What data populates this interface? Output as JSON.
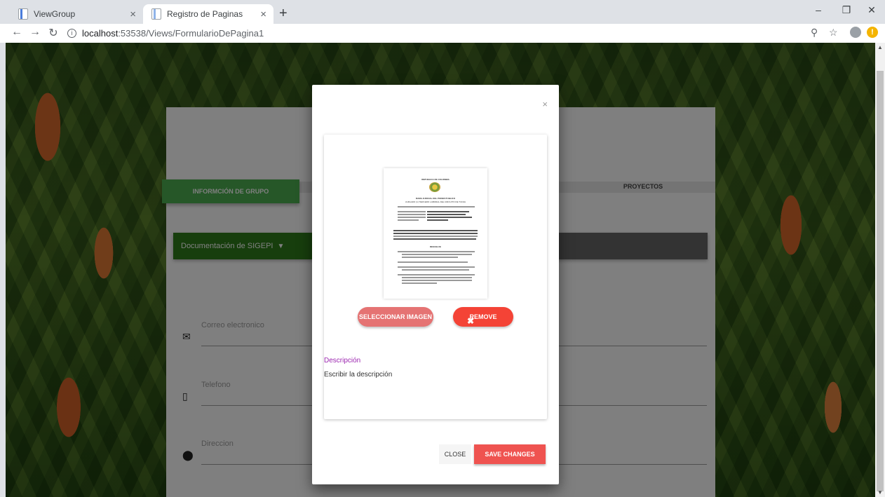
{
  "browser": {
    "tabs": [
      {
        "title": "ViewGroup"
      },
      {
        "title": "Registro de Paginas"
      }
    ],
    "url_host": "localhost",
    "url_rest": ":53538/Views/FormularioDePagina1"
  },
  "page": {
    "tabs": {
      "info": "INFORMCIÓN DE GRUPO",
      "projects": "PROYECTOS"
    },
    "accordion": {
      "title": "Documentación de SIGEPI"
    },
    "fields": [
      {
        "label": "Correo electronico",
        "icon": "envelope-icon"
      },
      {
        "label": "Telefono",
        "icon": "phone-icon"
      },
      {
        "label": "Direccion",
        "icon": "location-icon"
      }
    ]
  },
  "modal": {
    "close_x": "×",
    "document": {
      "line1": "REPUBLICA DE COLOMBIA",
      "line2": "RAMA JUDICIAL DEL PODER PUBLICO",
      "line3": "JUZGADO (1) TERCERO LABORAL DEL CIRCUITO DE TUNJA",
      "line4": "RESUELVE"
    },
    "select_image_label": "SELECCIONAR IMAGEN",
    "remove_label": "REMOVE",
    "description_label": "Descripción",
    "description_text": "Escribir la descripción",
    "close_label": "CLOSE",
    "save_label": "SAVE CHANGES"
  }
}
